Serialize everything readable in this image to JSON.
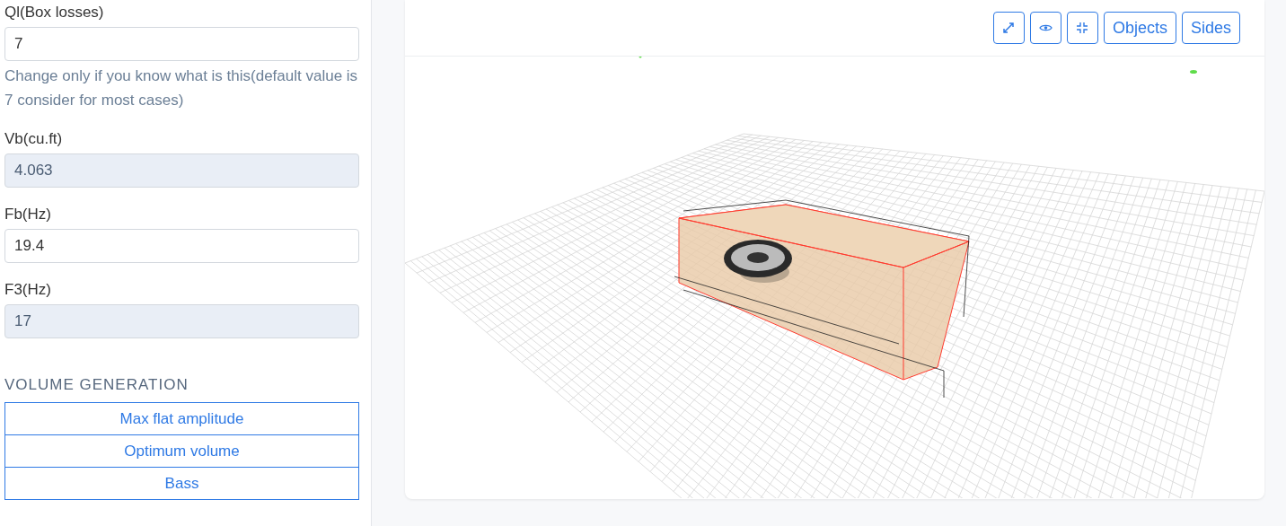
{
  "fields": [
    {
      "label": "Ql(Box losses)",
      "value": "7",
      "readonly": false,
      "help": "Change only if you know what is this(default value is 7 consider for most cases)"
    },
    {
      "label": "Vb(cu.ft)",
      "value": "4.063",
      "readonly": true
    },
    {
      "label": "Fb(Hz)",
      "value": "19.4",
      "readonly": false
    },
    {
      "label": "F3(Hz)",
      "value": "17",
      "readonly": true
    }
  ],
  "volume_generation": {
    "heading": "VOLUME GENERATION",
    "buttons": [
      "Max flat amplitude",
      "Optimum volume",
      "Bass"
    ]
  },
  "viewer": {
    "toolbar": [
      {
        "kind": "expand"
      },
      {
        "kind": "eye"
      },
      {
        "kind": "collapse"
      },
      {
        "kind": "text",
        "label": "Objects"
      },
      {
        "kind": "text",
        "label": "Sides"
      }
    ]
  }
}
